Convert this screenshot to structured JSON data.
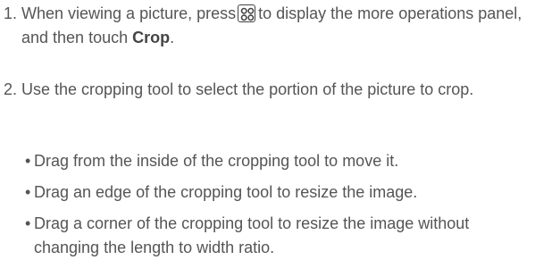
{
  "steps": [
    {
      "number": "1.",
      "before_icon": "When viewing a picture, press",
      "icon": "menu-key-icon",
      "after_icon": "to display the more operations panel, and then touch",
      "bold": "Crop",
      "end": "."
    },
    {
      "number": "2.",
      "text": "Use the cropping tool to select the portion of the picture to crop."
    }
  ],
  "bullets": [
    {
      "dot": "•",
      "text": "Drag from the inside of the cropping tool to move it."
    },
    {
      "dot": "•",
      "text": "Drag an edge of the cropping tool to resize the image."
    },
    {
      "dot": "•",
      "text": "Drag a corner of the cropping tool to resize the image without changing the length to width ratio."
    }
  ]
}
